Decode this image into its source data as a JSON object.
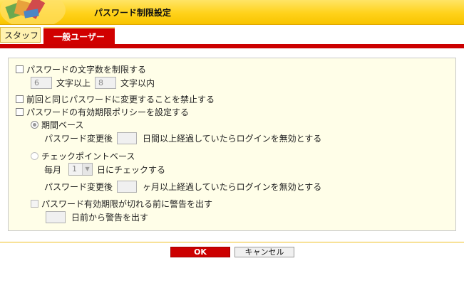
{
  "window": {
    "title": "パスワード制限設定"
  },
  "tabs": [
    {
      "label": "スタッフ",
      "active": false
    },
    {
      "label": "一般ユーザー",
      "active": true
    }
  ],
  "options": {
    "length_limit": {
      "checked": false,
      "label": "パスワードの文字数を制限する",
      "min_value": "6",
      "min_suffix": "文字以上",
      "max_value": "8",
      "max_suffix": "文字以内"
    },
    "no_reuse": {
      "checked": false,
      "label": "前回と同じパスワードに変更することを禁止する"
    },
    "expiry_policy": {
      "checked": false,
      "label": "パスワードの有効期限ポリシーを設定する",
      "period_based": {
        "selected": true,
        "label": "期間ベース",
        "prefix": "パスワード変更後",
        "days_value": "",
        "suffix": "日間以上経過していたらログインを無効とする"
      },
      "checkpoint_based": {
        "selected": false,
        "label": "チェックポイントベース",
        "monthly_prefix": "毎月",
        "day_value": "1",
        "day_suffix": "日にチェックする",
        "prefix": "パスワード変更後",
        "months_value": "",
        "suffix": "ヶ月以上経過していたらログインを無効とする"
      },
      "warning": {
        "checked": false,
        "label": "パスワード有効期限が切れる前に警告を出す",
        "days_value": "",
        "suffix": "日前から警告を出す"
      }
    }
  },
  "buttons": {
    "ok": "OK",
    "cancel": "キャンセル"
  },
  "colors": {
    "accent_red": "#cc0000",
    "title_yellow": "#ffd21a",
    "panel_bg": "#fffee8"
  }
}
